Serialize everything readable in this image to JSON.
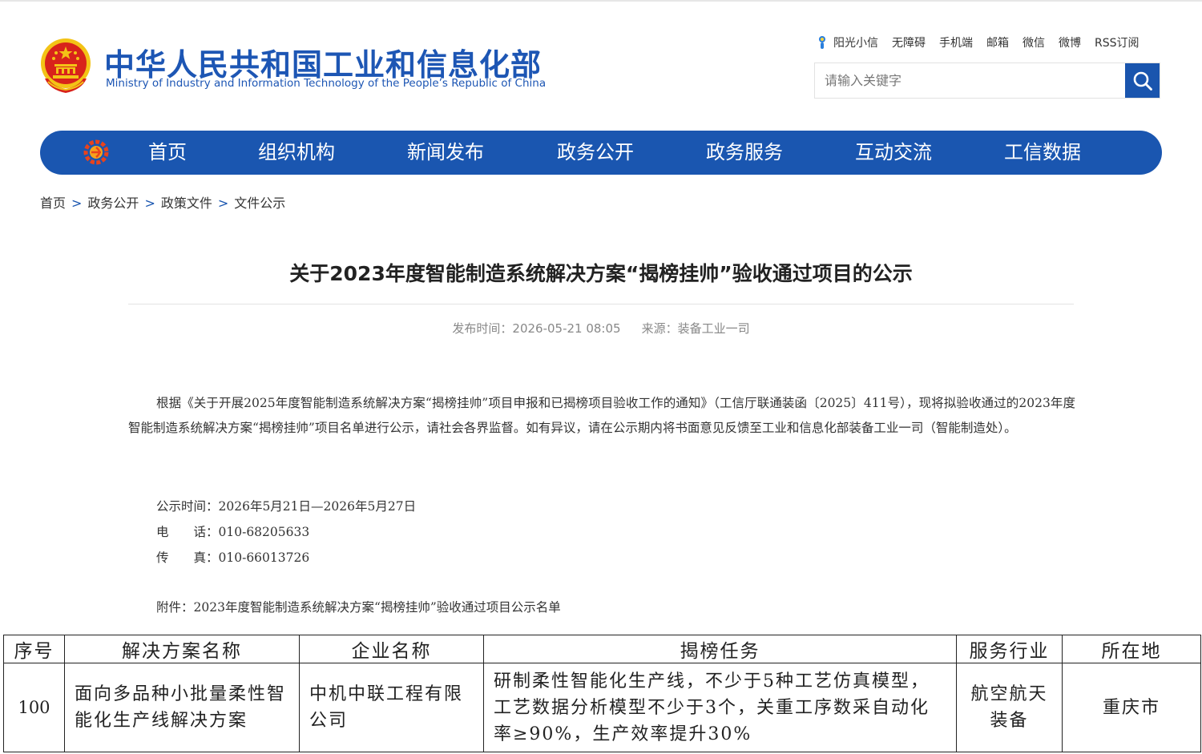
{
  "header": {
    "site_title": "中华人民共和国工业和信息化部",
    "site_subtitle": "Ministry of Industry and Information Technology of the People’s Republic of China",
    "top_links": [
      "阳光小信",
      "无障碍",
      "手机端",
      "邮箱",
      "微信",
      "微博",
      "RSS订阅"
    ],
    "search": {
      "placeholder": "请输入关键字",
      "value": ""
    }
  },
  "nav": {
    "items": [
      "首页",
      "组织机构",
      "新闻发布",
      "政务公开",
      "政务服务",
      "互动交流",
      "工信数据"
    ]
  },
  "breadcrumb": [
    "首页",
    "政务公开",
    "政策文件",
    "文件公示"
  ],
  "breadcrumb_separator": ">",
  "article": {
    "title": "关于2023年度智能制造系统解决方案“揭榜挂帅”验收通过项目的公示",
    "publish_time": "发布时间：2026-05-21 08:05",
    "source": "来源：装备工业一司",
    "body": "根据《关于开展2025年度智能制造系统解决方案“揭榜挂帅”项目申报和已揭榜项目验收工作的通知》（工信厅联通装函〔2025〕411号），现将拟验收通过的2023年度智能制造系统解决方案“揭榜挂帅”项目名单进行公示，请社会各界监督。如有异议，请在公示期内将书面意见反馈至工业和信息化部装备工业一司（智能制造处）。",
    "notice_period": "公示时间：2026年5月21日—2026年5月27日",
    "phone": "电　　话：010-68205633",
    "fax": "传　　真：010-66013726",
    "attachment": "附件：2023年度智能制造系统解决方案“揭榜挂帅”验收通过项目公示名单"
  },
  "table": {
    "headers": [
      "序号",
      "解决方案名称",
      "企业名称",
      "揭榜任务",
      "服务行业",
      "所在地"
    ],
    "rows": [
      {
        "no": "100",
        "solution": "面向多品种小批量柔性智能化生产线解决方案",
        "company": "中机中联工程有限公司",
        "task": "研制柔性智能化生产线，不少于5种工艺仿真模型，工艺数据分析模型不少于3个，关重工序数采自动化率≥90%，生产效率提升30%",
        "industry": "航空航天装备",
        "location": "重庆市"
      }
    ]
  },
  "colors": {
    "brand_blue": "#1a56b0",
    "title_blue": "#1d56b4",
    "emblem_red": "#d8231b",
    "emblem_gold": "#f3c316"
  }
}
